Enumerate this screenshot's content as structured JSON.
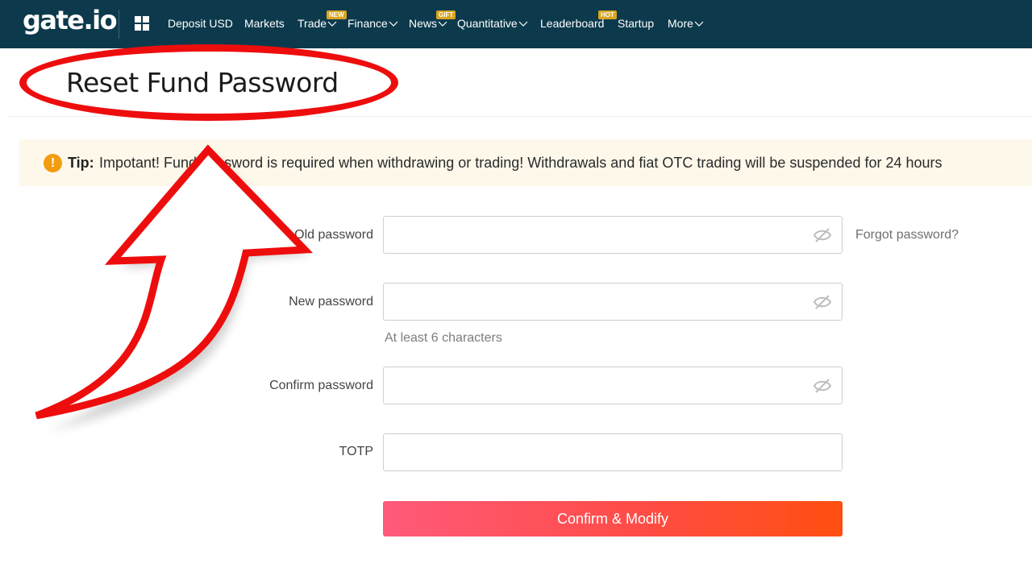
{
  "brand": {
    "logo": "gate.io"
  },
  "nav": {
    "deposit": "Deposit USD",
    "markets": "Markets",
    "trade": "Trade",
    "trade_badge": "NEW",
    "finance": "Finance",
    "news": "News",
    "news_badge": "GIFT",
    "quantitative": "Quantitative",
    "leaderboard": "Leaderboard",
    "leaderboard_badge": "HOT",
    "startup": "Startup",
    "more": "More"
  },
  "page": {
    "title": "Reset Fund Password"
  },
  "tip": {
    "label": "Tip:",
    "text": "Impotant! Fund password is required when withdrawing or trading! Withdrawals and fiat OTC trading will be suspended for 24 hours"
  },
  "form": {
    "old_password": {
      "label": "Old password",
      "value": ""
    },
    "new_password": {
      "label": "New password",
      "value": "",
      "hint": "At least 6 characters"
    },
    "confirm_password": {
      "label": "Confirm password",
      "value": ""
    },
    "totp": {
      "label": "TOTP",
      "value": ""
    },
    "forgot_link": "Forgot password?",
    "submit_label": "Confirm & Modify"
  },
  "icons": {
    "apps": "grid-icon",
    "visibility": "eye-off-icon",
    "tip": "exclamation-circle-icon"
  },
  "colors": {
    "topbar": "#0c3a4c",
    "accent_start": "#ff5a7a",
    "accent_end": "#ff4f10",
    "annotation": "#ee0d0d",
    "tip_bg": "#fdf8ea",
    "tip_icon": "#f39c0d"
  }
}
